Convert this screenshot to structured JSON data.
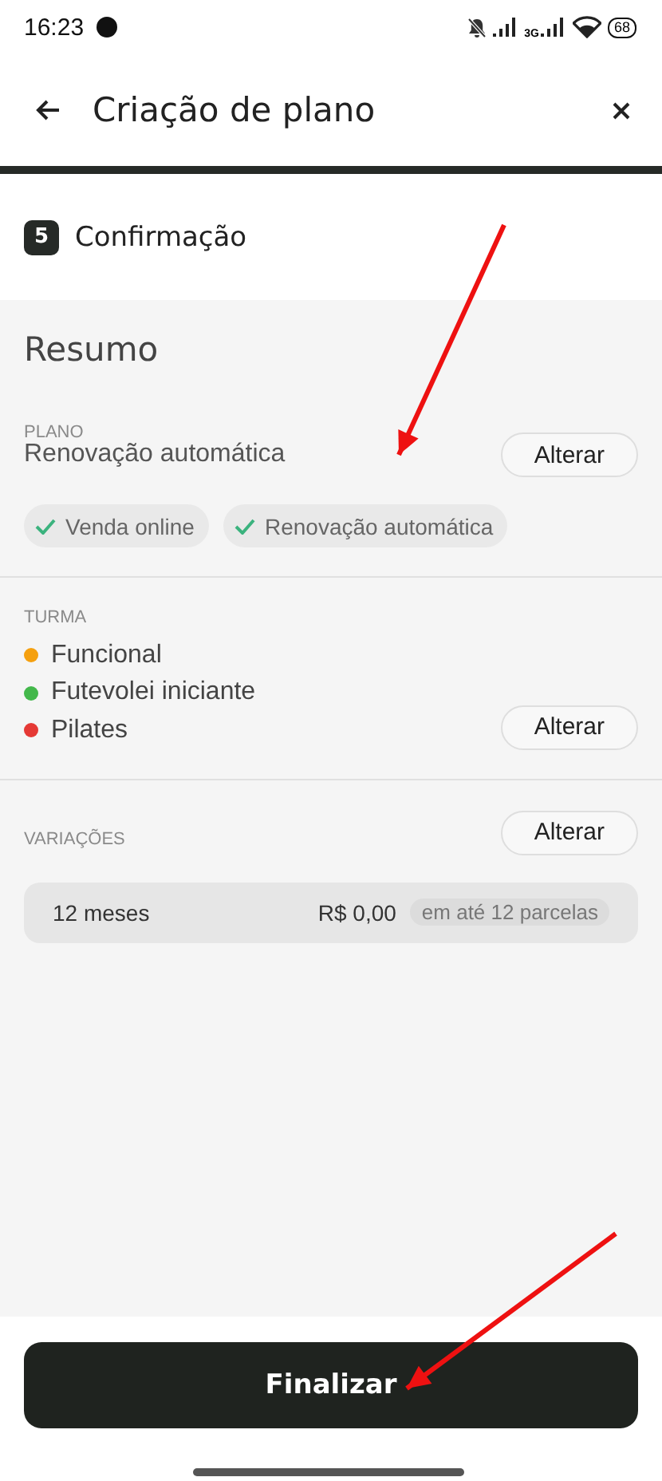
{
  "status_bar": {
    "time": "16:23",
    "network": "3G",
    "battery": "68"
  },
  "header": {
    "title": "Criação de plano"
  },
  "step": {
    "number": "5",
    "title": "Confirmação"
  },
  "summary": {
    "title": "Resumo",
    "plan": {
      "label": "PLANO",
      "name": "Renovação automática",
      "action": "Alterar",
      "features": [
        {
          "label": "Venda online",
          "checked": true
        },
        {
          "label": "Renovação automática",
          "checked": true
        }
      ]
    },
    "classes": {
      "label": "TURMA",
      "action": "Alterar",
      "items": [
        {
          "name": "Funcional",
          "color": "#f5a00f"
        },
        {
          "name": "Futevolei iniciante",
          "color": "#43b84b"
        },
        {
          "name": "Pilates",
          "color": "#e53935"
        }
      ]
    },
    "variations": {
      "label": "VARIAÇÕES",
      "action": "Alterar",
      "items": [
        {
          "name": "12 meses",
          "price": "R$ 0,00",
          "installments": "em até 12 parcelas"
        }
      ]
    }
  },
  "footer": {
    "button": "Finalizar"
  },
  "annotations": [
    {
      "kind": "arrow"
    },
    {
      "kind": "arrow"
    }
  ]
}
